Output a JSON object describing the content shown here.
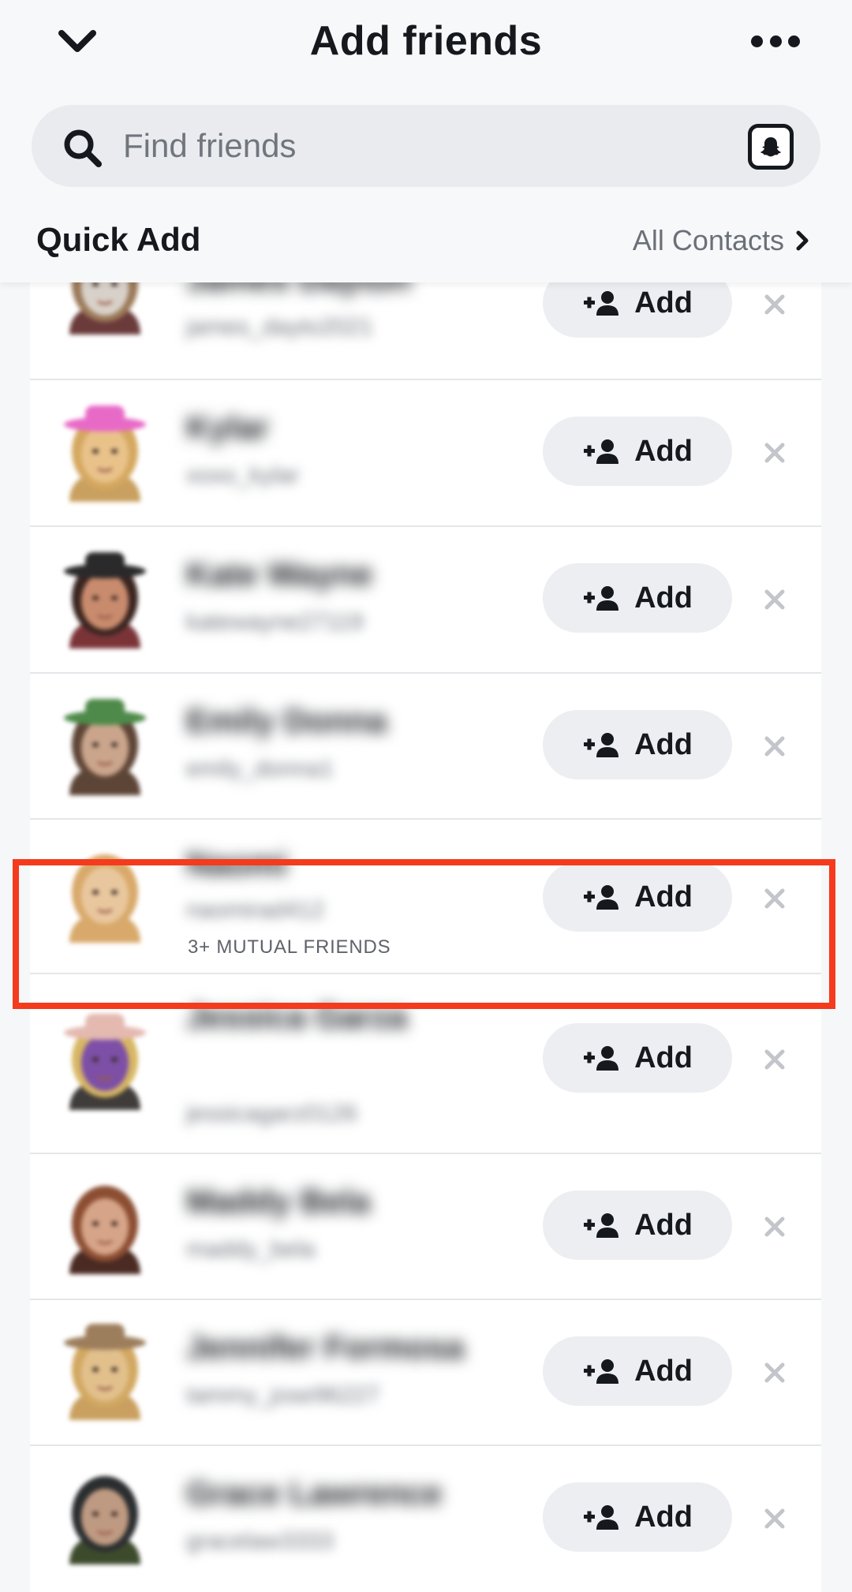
{
  "header": {
    "title": "Add friends",
    "search_placeholder": "Find friends",
    "section_title": "Quick Add",
    "all_contacts_label": "All Contacts"
  },
  "icons": {
    "back": "chevron-down-icon",
    "more": "more-options-icon",
    "search": "search-icon",
    "snapcode": "snapcode-icon",
    "add": "add-friend-icon",
    "dismiss": "close-icon"
  },
  "colors": {
    "highlight": "#f43b1d",
    "button_bg": "#eceef1",
    "search_bg": "#e9ebef"
  },
  "rows": [
    {
      "name": "James Dayton",
      "username": "james_dayto2021",
      "mutual": "",
      "add_label": "Add",
      "avatar": {
        "skin": "#d8d1c9",
        "hair": "#9b7a59",
        "hat": "#a1805f",
        "shirt": "#6b3a3a"
      }
    },
    {
      "name": "Kylar",
      "username": "xoxo_kylar",
      "mutual": "",
      "add_label": "Add",
      "avatar": {
        "skin": "#e9c28a",
        "hair": "#d5a860",
        "hat": "#e86ac7",
        "shirt": "#c9a05f"
      }
    },
    {
      "name": "Kate Wayne",
      "username": "katewayne27119",
      "mutual": "",
      "add_label": "Add",
      "avatar": {
        "skin": "#c98b6d",
        "hair": "#3a2520",
        "hat": "#2a2a2a",
        "shirt": "#7a3438"
      }
    },
    {
      "name": "Emily Donna",
      "username": "emily_donna1",
      "mutual": "",
      "add_label": "Add",
      "avatar": {
        "skin": "#caa58c",
        "hair": "#5e4536",
        "hat": "#4e8a4a",
        "shirt": "#5c4536"
      }
    },
    {
      "name": "Naomi",
      "username": "naomirad412",
      "mutual": "3+ MUTUAL FRIENDS",
      "add_label": "Add",
      "avatar": {
        "skin": "#e9c79e",
        "hair": "#d8a96a",
        "hat": "",
        "shirt": "#d8a96a"
      }
    },
    {
      "name": "Jessica Garza",
      "username": "jessicagarz0126",
      "mutual": "",
      "add_label": "Add",
      "avatar": {
        "skin": "#7d4fa6",
        "hair": "#d7b763",
        "hat": "#e4b9b0",
        "shirt": "#3f3c3a"
      }
    },
    {
      "name": "Maddy Bela",
      "username": "maddy_bela",
      "mutual": "",
      "add_label": "Add",
      "avatar": {
        "skin": "#d6a488",
        "hair": "#8c4e33",
        "hat": "",
        "shirt": "#4a2a22"
      }
    },
    {
      "name": "Jennifer Formosa",
      "username": "tammy_jose96227",
      "mutual": "",
      "add_label": "Add",
      "avatar": {
        "skin": "#e2c08c",
        "hair": "#d2a862",
        "hat": "#9d7e5c",
        "shirt": "#c9a05f"
      }
    },
    {
      "name": "Grace Lawrence",
      "username": "gracelaw3333",
      "mutual": "",
      "add_label": "Add",
      "avatar": {
        "skin": "#bf9a82",
        "hair": "#2b2e30",
        "hat": "",
        "shirt": "#3d4a2c"
      }
    }
  ]
}
